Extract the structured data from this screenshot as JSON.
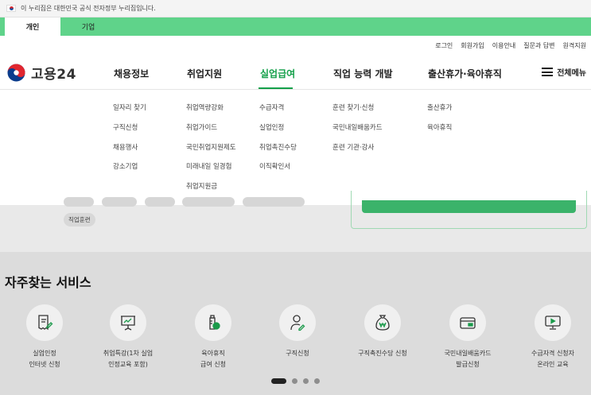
{
  "gov_notice": "이 누리집은 대한민국 공식 전자정부 누리집입니다.",
  "tabs": [
    {
      "label": "개인",
      "active": true
    },
    {
      "label": "기업",
      "active": false
    }
  ],
  "util_links": [
    "로그인",
    "회원가입",
    "이용안내",
    "질문과 답변",
    "원격지원"
  ],
  "logo_text": "고용24",
  "gnb": [
    {
      "label": "채용정보",
      "active": false,
      "sub": [
        "일자리 찾기",
        "구직신청",
        "채용행사",
        "강소기업"
      ]
    },
    {
      "label": "취업지원",
      "active": false,
      "sub": [
        "취업역량강화",
        "취업가이드",
        "국민취업지원제도",
        "미래내일 일경험",
        "취업지원금"
      ]
    },
    {
      "label": "실업급여",
      "active": true,
      "sub": [
        "수급자격",
        "실업인정",
        "취업촉진수당",
        "이직확인서"
      ]
    },
    {
      "label": "직업 능력 개발",
      "active": false,
      "sub": [
        "훈련 찾기·신청",
        "국민내일배움카드",
        "훈련 기관·강사"
      ]
    },
    {
      "label": "출산휴가·육아휴직",
      "active": false,
      "sub": [
        "출산휴가",
        "육아휴직"
      ]
    }
  ],
  "all_menu_label": "전체메뉴",
  "tag_pill": "직업훈련",
  "services": {
    "title": "자주찾는 서비스",
    "items": [
      {
        "label": "실업인정\n인터넷 신청",
        "icon": "receipt-pen-icon"
      },
      {
        "label": "취업특강(1차 실업\n인정교육 포함)",
        "icon": "presentation-board-icon"
      },
      {
        "label": "육아휴직\n급여 신청",
        "icon": "baby-bottle-icon"
      },
      {
        "label": "구직신청",
        "icon": "person-pen-icon"
      },
      {
        "label": "구직촉진수당 신청",
        "icon": "money-bag-icon"
      },
      {
        "label": "국민내일배움카드\n발급신청",
        "icon": "card-icon"
      },
      {
        "label": "수급자격 신청자\n온라인 교육",
        "icon": "monitor-play-icon"
      }
    ]
  },
  "pagination": {
    "pages": 4,
    "current": 1
  },
  "colors": {
    "brand_green": "#14a04a",
    "tab_bar": "#5fd38a"
  }
}
